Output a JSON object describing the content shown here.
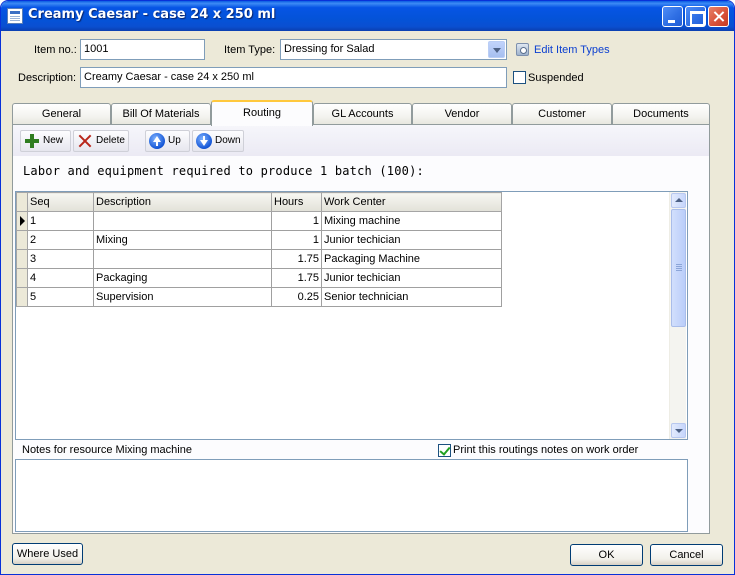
{
  "window": {
    "title": "Creamy Caesar - case 24 x 250 ml"
  },
  "header": {
    "item_no_label": "Item no.:",
    "item_no_value": "1001",
    "item_type_label": "Item Type:",
    "item_type_value": "Dressing for Salad",
    "edit_item_types_link": "Edit Item Types",
    "description_label": "Description:",
    "description_value": "Creamy Caesar - case 24 x 250 ml",
    "suspended_label": "Suspended",
    "suspended_checked": false
  },
  "tabs": [
    {
      "label": "General",
      "active": false
    },
    {
      "label": "Bill Of Materials",
      "active": false
    },
    {
      "label": "Routing",
      "active": true
    },
    {
      "label": "GL Accounts",
      "active": false
    },
    {
      "label": "Vendor",
      "active": false
    },
    {
      "label": "Customer",
      "active": false
    },
    {
      "label": "Documents",
      "active": false
    }
  ],
  "toolbar": {
    "new_label": "New",
    "delete_label": "Delete",
    "up_label": "Up",
    "down_label": "Down"
  },
  "routing": {
    "production_text": "Labor and equipment required to produce 1 batch (100):",
    "columns": [
      "Seq",
      "Description",
      "Hours",
      "Work Center"
    ],
    "rows": [
      {
        "seq": "1",
        "description": "",
        "hours": "1",
        "work_center": "Mixing machine"
      },
      {
        "seq": "2",
        "description": "Mixing",
        "hours": "1",
        "work_center": "Junior techician"
      },
      {
        "seq": "3",
        "description": "",
        "hours": "1.75",
        "work_center": "Packaging Machine"
      },
      {
        "seq": "4",
        "description": "Packaging",
        "hours": "1.75",
        "work_center": "Junior techician"
      },
      {
        "seq": "5",
        "description": "Supervision",
        "hours": "0.25",
        "work_center": "Senior technician"
      }
    ],
    "notes_label": "Notes for resource Mixing machine",
    "print_notes_label": "Print this routings notes on work order",
    "print_notes_checked": true,
    "notes_value": ""
  },
  "footer": {
    "where_used_label": "Where Used",
    "ok_label": "OK",
    "cancel_label": "Cancel"
  },
  "colors": {
    "titlebar": "#0654e5",
    "dialog_background": "#ece9d8",
    "active_tab_accent": "#ffc83d",
    "link": "#0b3fd0"
  }
}
